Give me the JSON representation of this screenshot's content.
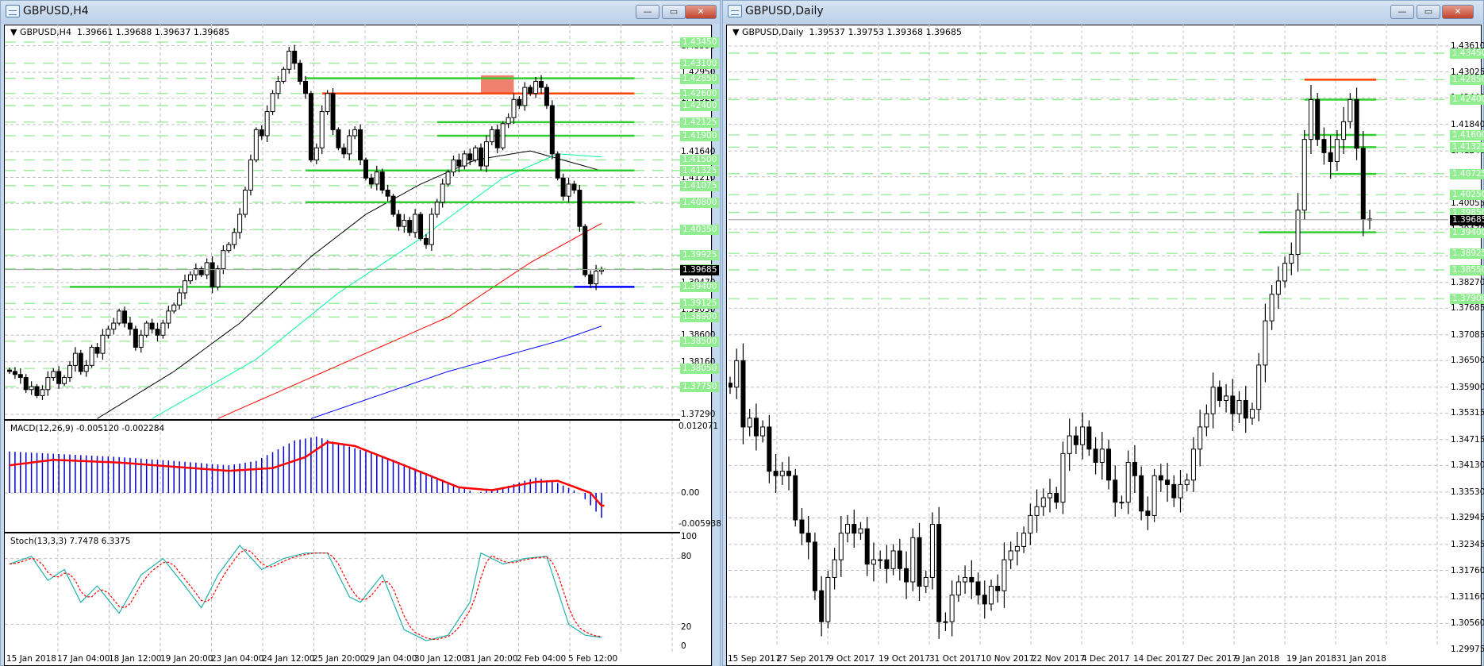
{
  "left_window": {
    "title": "GBPUSD,H4",
    "header": "GBPUSD,H4  1.39661 1.39688 1.39637 1.39685",
    "buttons": {
      "minimize": "—",
      "restore": "▭",
      "close": "✕"
    },
    "macd_label": "MACD(12,26,9) -0.005120 -0.002284",
    "stoch_label": "Stoch(13,3,3) 7.7478 6.3375",
    "macd_axis": [
      "0.012071",
      "0.00",
      "-0.005938"
    ],
    "stoch_axis": [
      "100",
      "80",
      "20",
      "0"
    ],
    "time_labels": [
      "15 Jan 2018",
      "17 Jan 04:00",
      "18 Jan 12:00",
      "19 Jan 20:00",
      "23 Jan 04:00",
      "24 Jan 12:00",
      "25 Jan 20:00",
      "29 Jan 04:00",
      "30 Jan 12:00",
      "31 Jan 20:00",
      "2 Feb 04:00",
      "5 Feb 12:00"
    ],
    "price_ticks": [
      "1.43390",
      "1.42950",
      "1.42520",
      "1.42085",
      "1.41640",
      "1.41210",
      "1.40780",
      "1.40345",
      "1.39905",
      "1.39470",
      "1.39030",
      "1.38600",
      "1.38160",
      "1.37725",
      "1.37290"
    ],
    "level_labels": [
      "1.43450",
      "1.43100",
      "1.42850",
      "1.42600",
      "1.42400",
      "1.42125",
      "1.41900",
      "1.41500",
      "1.41325",
      "1.41075",
      "1.40800",
      "1.40350",
      "1.39925",
      "1.39700",
      "1.39400",
      "1.39125",
      "1.38900",
      "1.38500",
      "1.38050",
      "1.37750"
    ],
    "current_price": "1.39685"
  },
  "right_window": {
    "title": "GBPUSD,Daily",
    "header": "GBPUSD,Daily  1.39537 1.39753 1.39368 1.39685",
    "buttons": {
      "minimize": "—",
      "restore": "▭",
      "close": "✕"
    },
    "time_labels": [
      "15 Sep 2017",
      "27 Sep 2017",
      "9 Oct 2017",
      "19 Oct 2017",
      "31 Oct 2017",
      "10 Nov 2017",
      "22 Nov 2017",
      "4 Dec 2017",
      "14 Dec 2017",
      "27 Dec 2017",
      "9 Jan 2018",
      "19 Jan 2018",
      "31 Jan 2018"
    ],
    "price_ticks": [
      "1.43610",
      "1.43025",
      "1.42440",
      "1.41840",
      "1.41240",
      "1.40655",
      "1.40055",
      "1.39470",
      "1.38870",
      "1.38270",
      "1.37685",
      "1.37085",
      "1.36500",
      "1.35900",
      "1.35315",
      "1.34715",
      "1.34130",
      "1.33530",
      "1.32945",
      "1.32345",
      "1.31760",
      "1.31160",
      "1.30560",
      "1.29975"
    ],
    "level_labels": [
      "1.43450",
      "1.42850",
      "1.42400",
      "1.41600",
      "1.41325",
      "1.40725",
      "1.40250",
      "1.39850",
      "1.39400",
      "1.38925",
      "1.38550",
      "1.37900"
    ],
    "current_price": "1.39685"
  },
  "colors": {
    "bull": "#ffffff",
    "bear": "#000000",
    "level_green": "#32cd32",
    "level_red": "#ff4500",
    "grid": "#c0c0c0",
    "label_green": "#90ee90",
    "ma_black": "#000000",
    "ma_aqua": "#00fa9a",
    "ma_red": "#ff0000",
    "ma_blue": "#0000ff",
    "macd_hist": "#0000cd",
    "macd_signal": "#ff0000",
    "stoch_main": "#20b2aa",
    "stoch_signal": "#ff0000"
  },
  "chart_data": [
    {
      "type": "candlestick",
      "title": "GBPUSD,H4",
      "ylim": [
        1.3721,
        1.4367
      ],
      "close": [
        1.38,
        1.3795,
        1.379,
        1.377,
        1.3775,
        1.376,
        1.377,
        1.379,
        1.38,
        1.378,
        1.379,
        1.381,
        1.383,
        1.38,
        1.381,
        1.384,
        1.383,
        1.386,
        1.387,
        1.388,
        1.39,
        1.388,
        1.387,
        1.384,
        1.386,
        1.388,
        1.387,
        1.386,
        1.388,
        1.39,
        1.391,
        1.393,
        1.395,
        1.396,
        1.397,
        1.396,
        1.398,
        1.394,
        1.397,
        1.4,
        1.401,
        1.403,
        1.406,
        1.41,
        1.415,
        1.42,
        1.419,
        1.423,
        1.426,
        1.428,
        1.43,
        1.433,
        1.431,
        1.428,
        1.426,
        1.415,
        1.417,
        1.423,
        1.426,
        1.42,
        1.417,
        1.416,
        1.419,
        1.42,
        1.415,
        1.412,
        1.411,
        1.413,
        1.41,
        1.409,
        1.406,
        1.404,
        1.405,
        1.403,
        1.406,
        1.402,
        1.401,
        1.406,
        1.408,
        1.411,
        1.413,
        1.415,
        1.414,
        1.416,
        1.415,
        1.417,
        1.414,
        1.418,
        1.42,
        1.417,
        1.421,
        1.422,
        1.425,
        1.424,
        1.427,
        1.426,
        1.428,
        1.427,
        1.424,
        1.416,
        1.412,
        1.409,
        1.411,
        1.41,
        1.404,
        1.396,
        1.3945,
        1.3966,
        1.3968
      ],
      "moving_averages": [
        {
          "name": "MA black",
          "points": [
            [
              16,
              1.3722
            ],
            [
              30,
              1.38
            ],
            [
              42,
              1.388
            ],
            [
              55,
              1.399
            ],
            [
              65,
              1.406
            ],
            [
              75,
              1.411
            ],
            [
              85,
              1.415
            ],
            [
              95,
              1.4165
            ],
            [
              108,
              1.4132
            ]
          ]
        },
        {
          "name": "MA aqua",
          "points": [
            [
              26,
              1.3722
            ],
            [
              45,
              1.382
            ],
            [
              60,
              1.393
            ],
            [
              75,
              1.402
            ],
            [
              90,
              1.412
            ],
            [
              100,
              1.416
            ],
            [
              108,
              1.4155
            ]
          ]
        },
        {
          "name": "MA red",
          "points": [
            [
              38,
              1.3722
            ],
            [
              60,
              1.381
            ],
            [
              80,
              1.389
            ],
            [
              95,
              1.398
            ],
            [
              108,
              1.4045
            ]
          ]
        },
        {
          "name": "MA blue",
          "points": [
            [
              55,
              1.3722
            ],
            [
              80,
              1.38
            ],
            [
              100,
              1.385
            ],
            [
              108,
              1.3875
            ]
          ]
        }
      ],
      "levels": [
        {
          "price": 1.4285,
          "from": 54,
          "to": 114,
          "color": "green"
        },
        {
          "price": 1.426,
          "from": 57,
          "to": 114,
          "color": "red"
        },
        {
          "price": 1.42125,
          "from": 78,
          "to": 114,
          "color": "green"
        },
        {
          "price": 1.419,
          "from": 78,
          "to": 114,
          "color": "green"
        },
        {
          "price": 1.41325,
          "from": 54,
          "to": 114,
          "color": "green"
        },
        {
          "price": 1.408,
          "from": 54,
          "to": 114,
          "color": "green"
        },
        {
          "price": 1.394,
          "from": 11,
          "to": 103,
          "color": "green"
        },
        {
          "price": 1.394,
          "from": 103,
          "to": 114,
          "color": "blue"
        }
      ],
      "zone": {
        "from": 86,
        "to": 92,
        "low": 1.426,
        "high": 1.429,
        "color": "#f08070"
      },
      "macd": {
        "hist": [
          [
            0,
            0.0075
          ],
          [
            10,
            0.007
          ],
          [
            20,
            0.0065
          ],
          [
            30,
            0.0058
          ],
          [
            40,
            0.005
          ],
          [
            45,
            0.0058
          ],
          [
            52,
            0.0095
          ],
          [
            56,
            0.0102
          ],
          [
            60,
            0.009
          ],
          [
            70,
            0.006
          ],
          [
            80,
            0.002
          ],
          [
            85,
            0.0
          ],
          [
            90,
            0.001
          ],
          [
            96,
            0.0028
          ],
          [
            100,
            0.0018
          ],
          [
            104,
            0.0
          ],
          [
            108,
            -0.0045
          ]
        ],
        "signal": [
          [
            0,
            0.005
          ],
          [
            8,
            0.006
          ],
          [
            20,
            0.0055
          ],
          [
            40,
            0.004
          ],
          [
            48,
            0.0045
          ],
          [
            54,
            0.0065
          ],
          [
            58,
            0.0092
          ],
          [
            63,
            0.0085
          ],
          [
            72,
            0.005
          ],
          [
            82,
            0.001
          ],
          [
            88,
            0.0005
          ],
          [
            96,
            0.002
          ],
          [
            100,
            0.0022
          ],
          [
            106,
            0.0
          ],
          [
            108,
            -0.0023
          ]
        ],
        "ylim": [
          -0.005938,
          0.012071
        ]
      },
      "stoch": {
        "main": [
          [
            0,
            75
          ],
          [
            4,
            82
          ],
          [
            7,
            60
          ],
          [
            10,
            70
          ],
          [
            13,
            40
          ],
          [
            16,
            55
          ],
          [
            20,
            30
          ],
          [
            24,
            65
          ],
          [
            28,
            80
          ],
          [
            32,
            55
          ],
          [
            35,
            35
          ],
          [
            38,
            65
          ],
          [
            42,
            92
          ],
          [
            46,
            70
          ],
          [
            50,
            80
          ],
          [
            54,
            85
          ],
          [
            58,
            85
          ],
          [
            62,
            45
          ],
          [
            64,
            40
          ],
          [
            68,
            65
          ],
          [
            72,
            15
          ],
          [
            76,
            5
          ],
          [
            80,
            10
          ],
          [
            84,
            40
          ],
          [
            86,
            85
          ],
          [
            90,
            75
          ],
          [
            94,
            80
          ],
          [
            98,
            82
          ],
          [
            102,
            20
          ],
          [
            105,
            10
          ],
          [
            108,
            8
          ]
        ],
        "ylim": [
          0,
          100
        ]
      }
    },
    {
      "type": "candlestick",
      "title": "GBPUSD,Daily",
      "ylim": [
        1.29975,
        1.4375
      ],
      "close": [
        1.359,
        1.365,
        1.35,
        1.352,
        1.348,
        1.35,
        1.34,
        1.339,
        1.34,
        1.339,
        1.329,
        1.326,
        1.324,
        1.313,
        1.306,
        1.316,
        1.32,
        1.326,
        1.328,
        1.326,
        1.327,
        1.319,
        1.32,
        1.32,
        1.318,
        1.322,
        1.318,
        1.315,
        1.325,
        1.314,
        1.316,
        1.328,
        1.306,
        1.306,
        1.312,
        1.315,
        1.316,
        1.315,
        1.312,
        1.31,
        1.314,
        1.313,
        1.32,
        1.322,
        1.323,
        1.326,
        1.33,
        1.332,
        1.334,
        1.335,
        1.333,
        1.344,
        1.348,
        1.346,
        1.35,
        1.345,
        1.342,
        1.345,
        1.338,
        1.333,
        1.333,
        1.342,
        1.339,
        1.331,
        1.33,
        1.339,
        1.338,
        1.337,
        1.334,
        1.337,
        1.338,
        1.345,
        1.35,
        1.353,
        1.359,
        1.356,
        1.357,
        1.353,
        1.356,
        1.352,
        1.354,
        1.364,
        1.374,
        1.38,
        1.383,
        1.387,
        1.389,
        1.399,
        1.415,
        1.424,
        1.415,
        1.412,
        1.41,
        1.415,
        1.419,
        1.424,
        1.413,
        1.397,
        1.3968
      ],
      "levels": [
        {
          "price": 1.4285,
          "from": 88,
          "to": 99,
          "color": "red"
        },
        {
          "price": 1.424,
          "from": 88,
          "to": 99,
          "color": "green"
        },
        {
          "price": 1.416,
          "from": 88,
          "to": 99,
          "color": "green"
        },
        {
          "price": 1.41325,
          "from": 92,
          "to": 99,
          "color": "green"
        },
        {
          "price": 1.4072,
          "from": 92,
          "to": 99,
          "color": "green"
        },
        {
          "price": 1.394,
          "from": 81,
          "to": 99,
          "color": "green"
        }
      ]
    }
  ]
}
